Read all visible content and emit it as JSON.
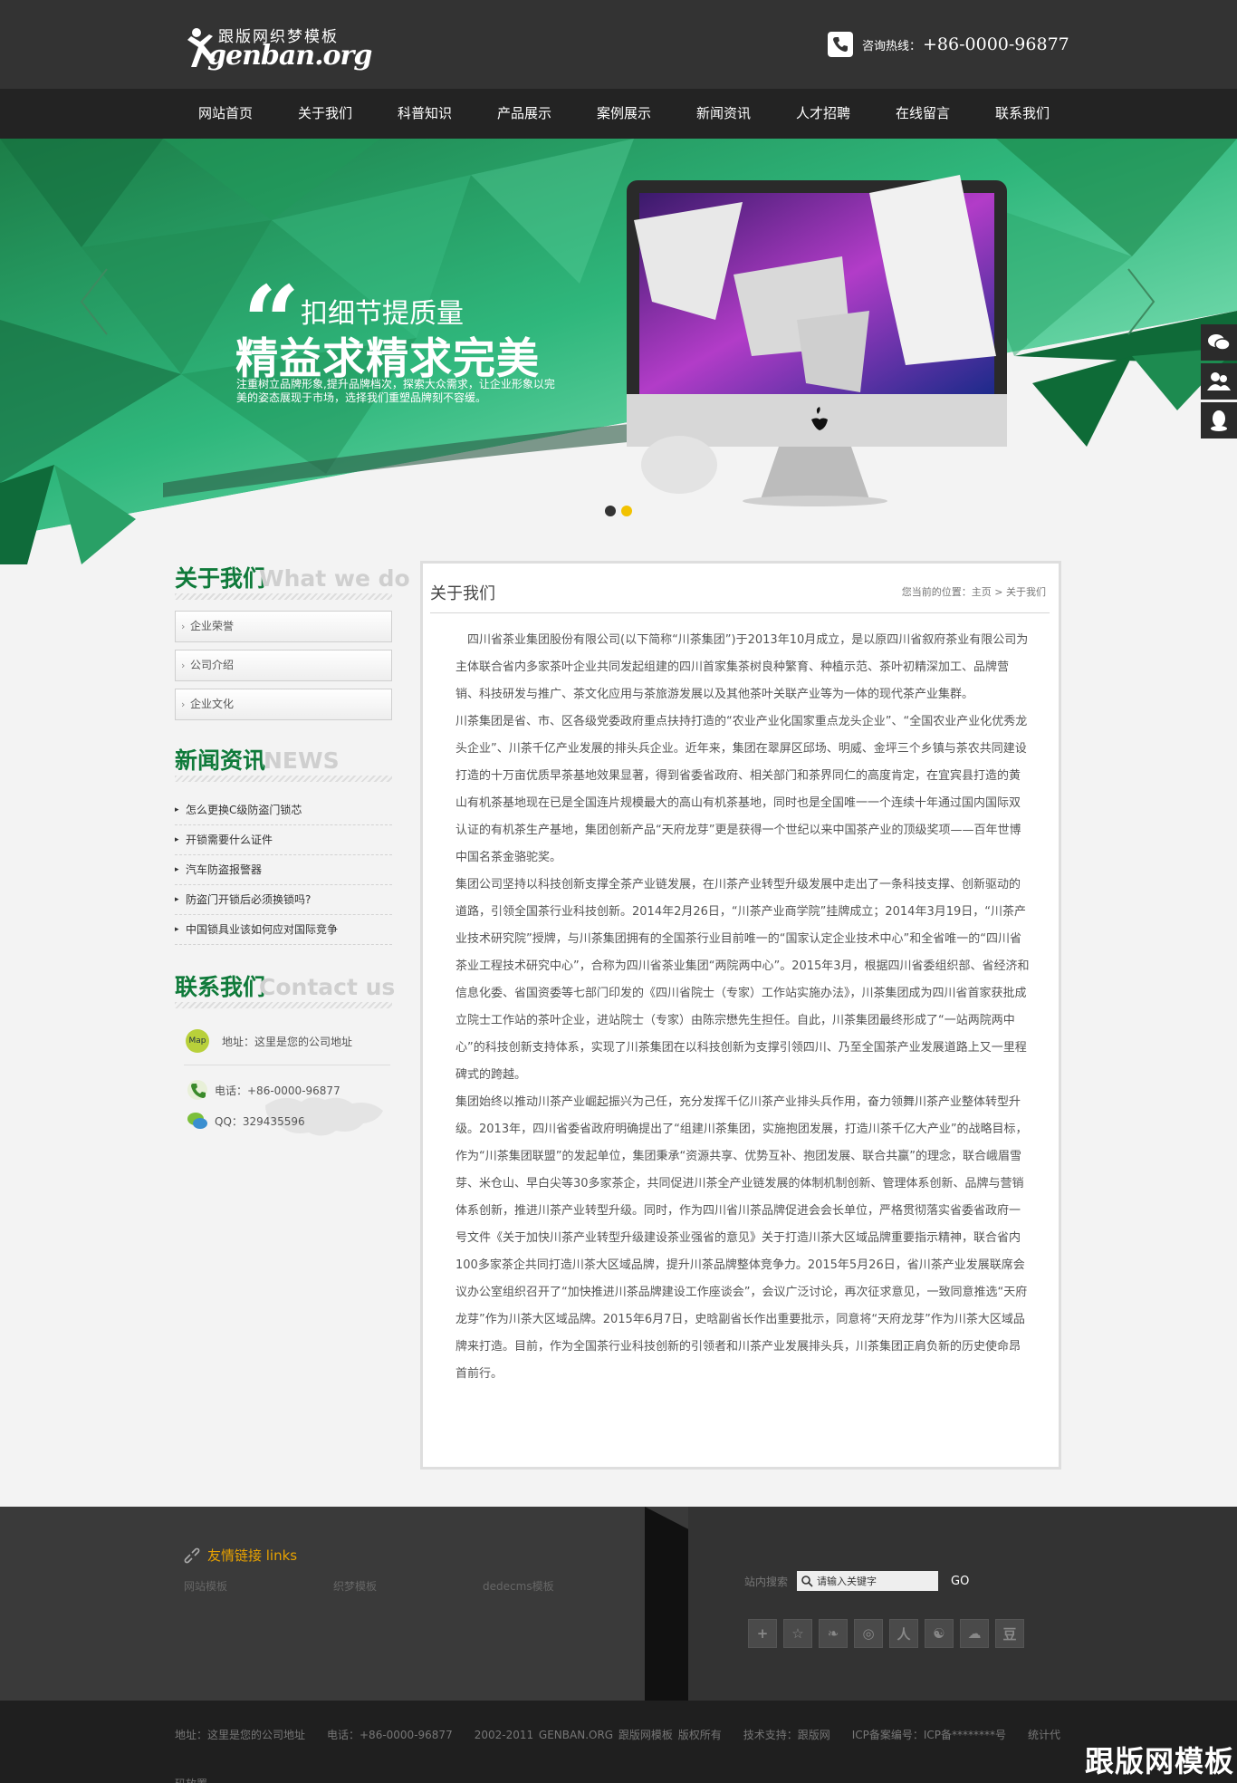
{
  "logo": {
    "top": "跟版网织梦模板",
    "main": "genban.org"
  },
  "header": {
    "hotline_label": "咨询热线：",
    "hotline_number": "+86-0000-96877"
  },
  "nav": [
    "网站首页",
    "关于我们",
    "科普知识",
    "产品展示",
    "案例展示",
    "新闻资讯",
    "人才招聘",
    "在线留言",
    "联系我们"
  ],
  "banner": {
    "quote": "“",
    "slogan_small": "扣细节提质量",
    "slogan_big": "精益求精求完美",
    "slogan_desc": "注重树立品牌形象,提升品牌档次，探索大众需求，让企业形象以完美的姿态展现于市场，选择我们重塑品牌刻不容缓。",
    "dot_colors": [
      "#333333",
      "#f2c200"
    ]
  },
  "about": {
    "title_cn": "关于我们",
    "title_en": "What we do",
    "menu": [
      "企业荣誉",
      "公司介绍",
      "企业文化"
    ]
  },
  "news": {
    "title_cn": "新闻资讯",
    "title_en": "NEWS",
    "items": [
      "怎么更换C级防盗门锁芯",
      "开锁需要什么证件",
      "汽车防盗报警器",
      "防盗门开锁后必须换锁吗?",
      "中国锁具业该如何应对国际竞争"
    ]
  },
  "contact": {
    "title_cn": "联系我们",
    "title_en": "Contact us",
    "map_badge": "Map",
    "address": "地址：这里是您的公司地址",
    "phone": "电话：+86-0000-96877",
    "qq": "QQ：329435596"
  },
  "panel": {
    "title": "关于我们",
    "breadcrumb_prefix": "您当前的位置：",
    "breadcrumb_home": "主页",
    "breadcrumb_sep": " > ",
    "breadcrumb_current": "关于我们",
    "paragraphs": [
      "　四川省茶业集团股份有限公司(以下简称“川茶集团”)于2013年10月成立，是以原四川省叙府茶业有限公司为主体联合省内多家茶叶企业共同发起组建的四川首家集茶树良种繁育、种植示范、茶叶初精深加工、品牌营销、科技研发与推广、茶文化应用与茶旅游发展以及其他茶叶关联产业等为一体的现代茶产业集群。",
      "川茶集团是省、市、区各级党委政府重点扶持打造的“农业产业化国家重点龙头企业”、“全国农业产业化优秀龙头企业”、川茶千亿产业发展的排头兵企业。近年来，集团在翠屏区邱场、明威、金坪三个乡镇与茶农共同建设打造的十万亩优质早茶基地效果显著，得到省委省政府、相关部门和茶界同仁的高度肯定，在宜宾县打造的黄山有机茶基地现在已是全国连片规模最大的高山有机茶基地，同时也是全国唯一一个连续十年通过国内国际双认证的有机茶生产基地，集团创新产品“天府龙芽”更是获得一个世纪以来中国茶产业的顶级奖项——百年世博中国名茶金骆驼奖。",
      "集团公司坚持以科技创新支撑全茶产业链发展，在川茶产业转型升级发展中走出了一条科技支撑、创新驱动的道路，引领全国茶行业科技创新。2014年2月26日，“川茶产业商学院”挂牌成立；2014年3月19日，“川茶产业技术研究院”授牌，与川茶集团拥有的全国茶行业目前唯一的“国家认定企业技术中心”和全省唯一的“四川省茶业工程技术研究中心”，合称为四川省茶业集团“两院两中心”。2015年3月，根据四川省委组织部、省经济和信息化委、省国资委等七部门印发的《四川省院士（专家）工作站实施办法》，川茶集团成为四川省首家获批成立院士工作站的茶叶企业，进站院士（专家）由陈宗懋先生担任。自此，川茶集团最终形成了“一站两院两中心”的科技创新支持体系，实现了川茶集团在以科技创新为支撑引领四川、乃至全国茶产业发展道路上又一里程碑式的跨越。",
      "集团始终以推动川茶产业崛起振兴为己任，充分发挥千亿川茶产业排头兵作用，奋力领舞川茶产业整体转型升级。2013年，四川省委省政府明确提出了“组建川茶集团，实施抱团发展，打造川茶千亿大产业”的战略目标，作为“川茶集团联盟”的发起单位，集团秉承“资源共享、优势互补、抱团发展、联合共赢”的理念，联合峨眉雪芽、米仓山、早白尖等30多家茶企，共同促进川茶全产业链发展的体制机制创新、管理体系创新、品牌与营销体系创新，推进川茶产业转型升级。同时，作为四川省川茶品牌促进会会长单位，严格贯彻落实省委省政府一号文件《关于加快川茶产业转型升级建设茶业强省的意见》关于打造川茶大区域品牌重要指示精神，联合省内100多家茶企共同打造川茶大区域品牌，提升川茶品牌整体竞争力。2015年5月26日，省川茶产业发展联席会议办公室组织召开了“加快推进川茶品牌建设工作座谈会”，会议广泛讨论，再次征求意见，一致同意推选“天府龙芽”作为川茶大区域品牌。2015年6月7日，史晗副省长作出重要批示，同意将“天府龙芽”作为川茶大区域品牌来打造。目前，作为全国茶行业科技创新的引领者和川茶产业发展排头兵，川茶集团正肩负新的历史使命昂首前行。"
    ]
  },
  "footer": {
    "links_title": "友情链接 links",
    "links": [
      "网站模板",
      "织梦模板",
      "dedecms模板"
    ],
    "search_label": "站内搜索",
    "search_placeholder": "请输入关键字",
    "go": "GO",
    "social": [
      "+",
      "☆",
      "❧",
      "◎",
      "人",
      "☯",
      "☁",
      "豆"
    ],
    "copyright": "地址：这里是您的公司地址　　电话：+86-0000-96877　　2002-2011 GENBAN.ORG 跟版网模板 版权所有　　技术支持：跟版网　　ICP备案编号：ICP备********号　　统计代码放置",
    "watermark": "跟版网模板"
  },
  "colors": {
    "brand_green": "#0f7a3a",
    "accent_yellow": "#e8a200"
  }
}
